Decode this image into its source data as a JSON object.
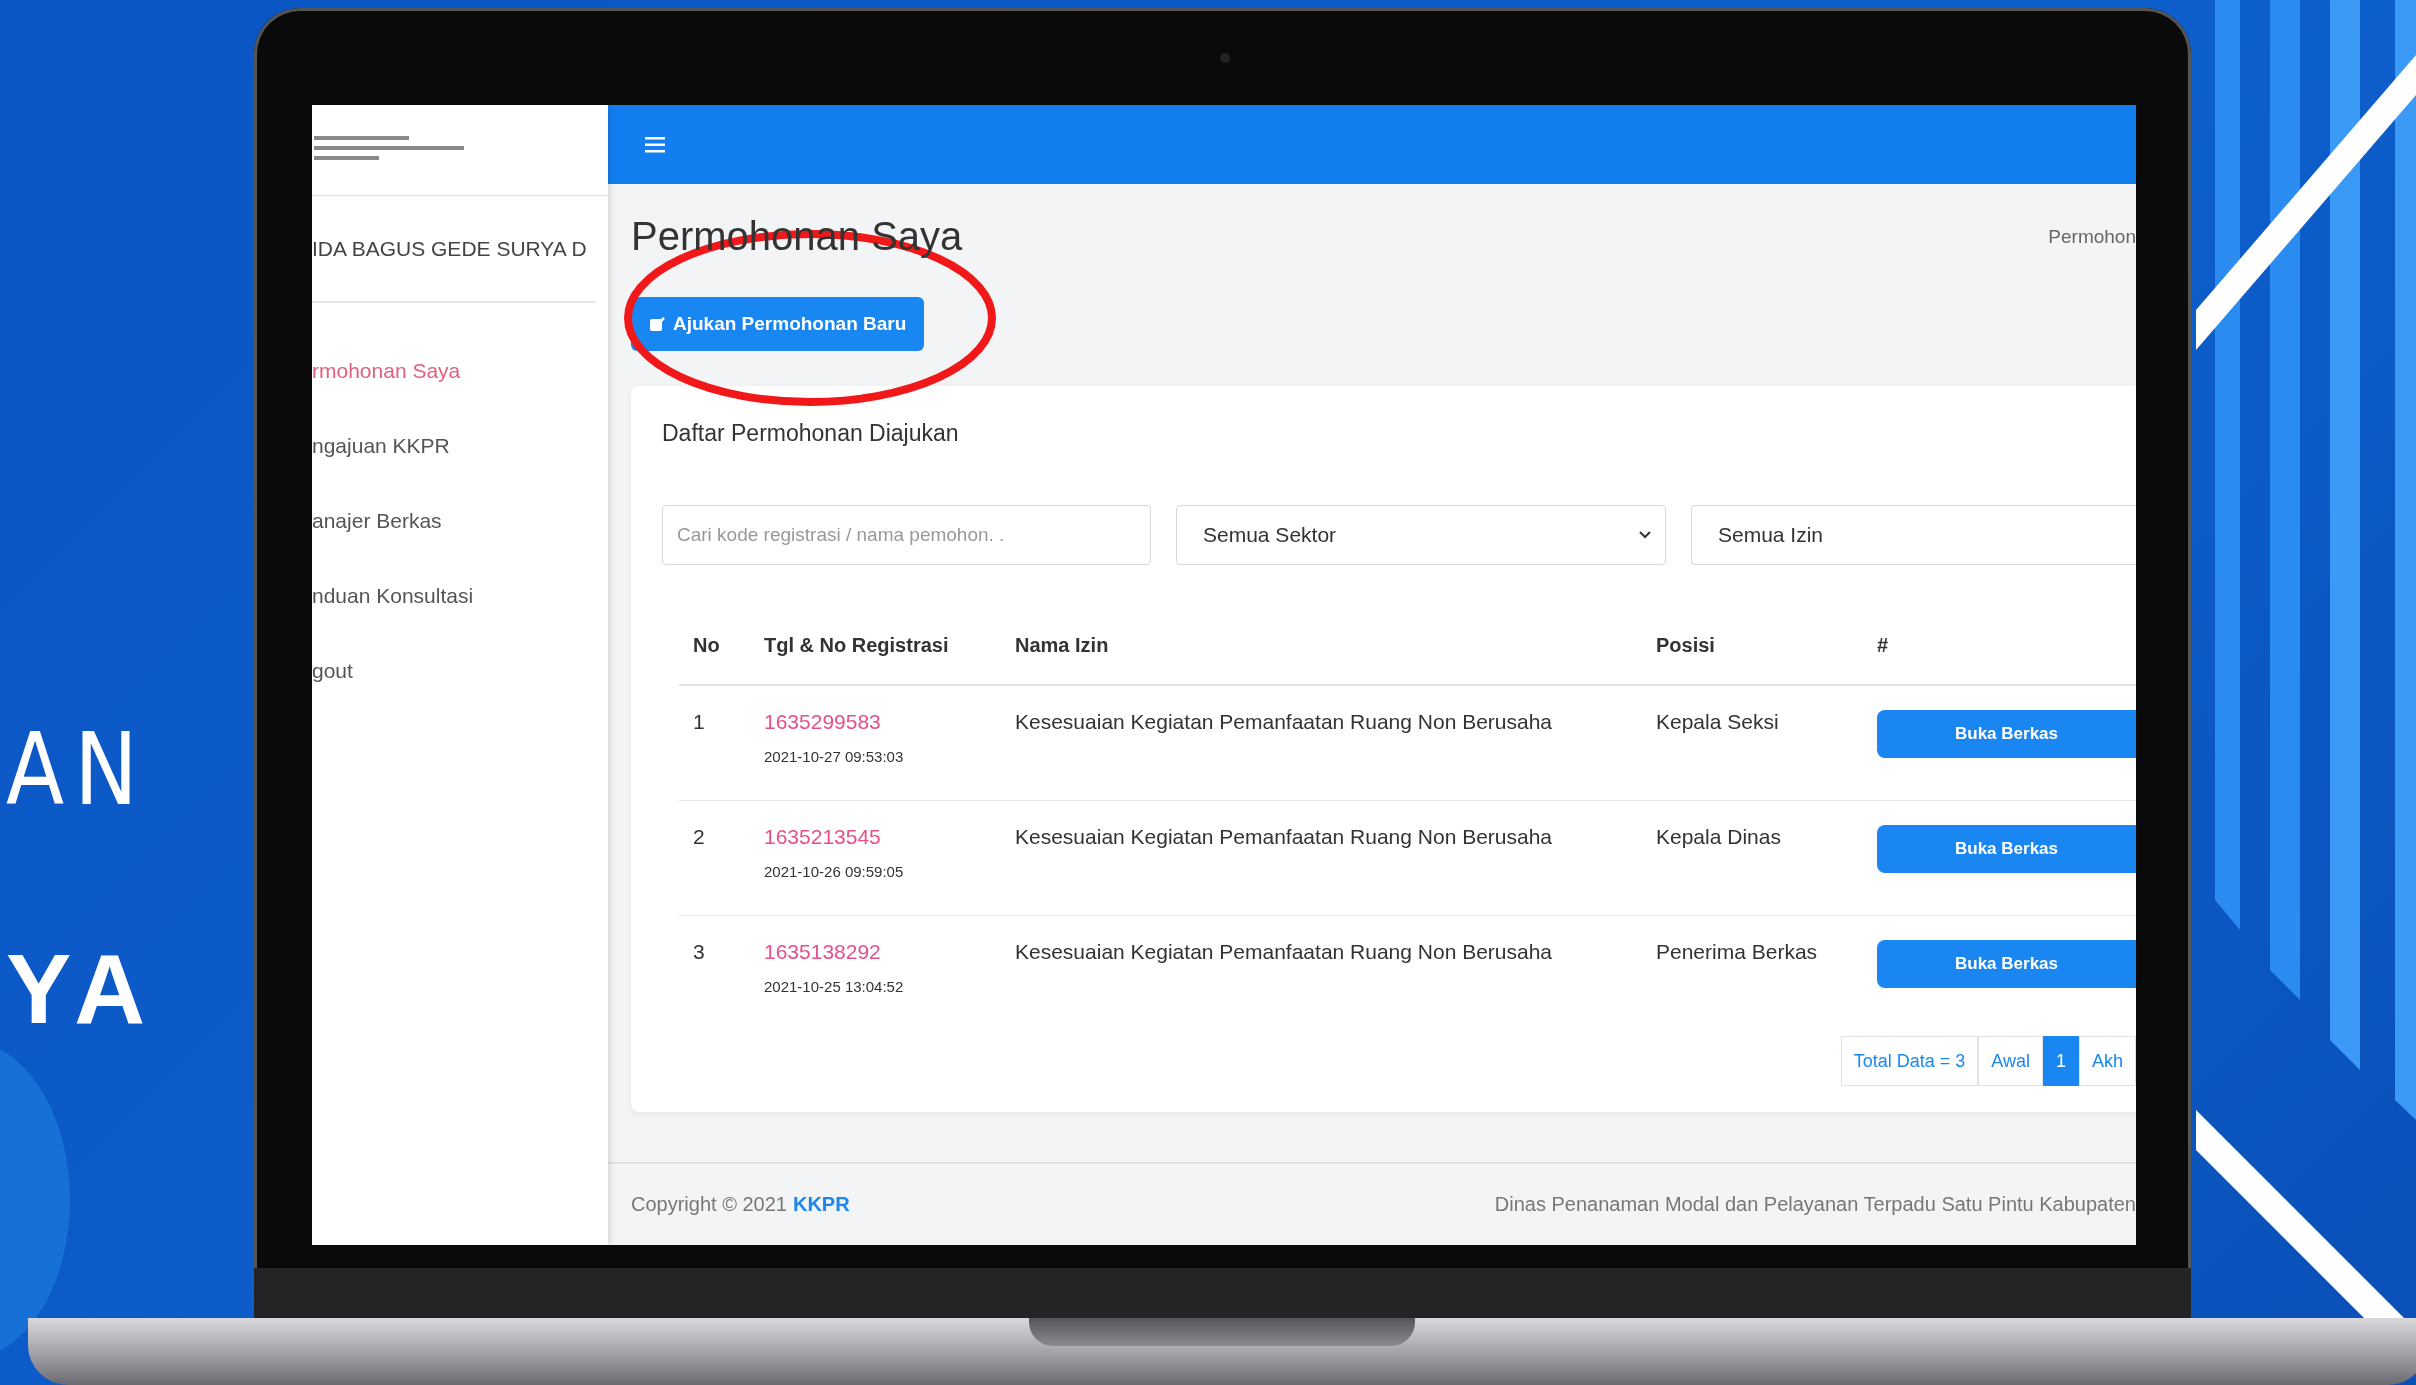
{
  "background_text": [
    {
      "text": "AN",
      "kind": "light"
    },
    {
      "text": "YA",
      "kind": "bold"
    }
  ],
  "sidebar": {
    "user_name": "IDA BAGUS GEDE SURYA D",
    "items": [
      {
        "label": "rmohonan Saya",
        "selected": true
      },
      {
        "label": "ngajuan KKPR",
        "selected": false
      },
      {
        "label": "anajer Berkas",
        "selected": false
      },
      {
        "label": "nduan Konsultasi",
        "selected": false
      },
      {
        "label": "gout",
        "selected": false
      }
    ]
  },
  "page": {
    "title": "Permohonan Saya",
    "breadcrumb": "Permohon",
    "new_button": "Ajukan Permohonan Baru"
  },
  "card": {
    "title": "Daftar Permohonan Diajukan",
    "search": {
      "placeholder": "Cari kode registrasi / nama pemohon. ."
    },
    "filters": [
      {
        "value": "Semua Sektor",
        "chevron": true
      },
      {
        "value": "Semua Izin",
        "chevron": false
      }
    ],
    "table": {
      "columns": [
        "No",
        "Tgl & No Registrasi",
        "Nama Izin",
        "Posisi",
        "#"
      ],
      "rows": [
        {
          "no": "1",
          "registration": "1635299583",
          "datetime": "2021-10-27 09:53:03",
          "permit": "Kesesuaian Kegiatan Pemanfaatan Ruang Non Berusaha",
          "position": "Kepala Seksi",
          "action": "Buka Berkas"
        },
        {
          "no": "2",
          "registration": "1635213545",
          "datetime": "2021-10-26 09:59:05",
          "permit": "Kesesuaian Kegiatan Pemanfaatan Ruang Non Berusaha",
          "position": "Kepala Dinas",
          "action": "Buka Berkas"
        },
        {
          "no": "3",
          "registration": "1635138292",
          "datetime": "2021-10-25 13:04:52",
          "permit": "Kesesuaian Kegiatan Pemanfaatan Ruang Non Berusaha",
          "position": "Penerima Berkas",
          "action": "Buka Berkas"
        }
      ]
    },
    "pagination": {
      "total": "Total Data = 3",
      "items": [
        {
          "label": "Awal",
          "selected": false
        },
        {
          "label": "1",
          "selected": true
        },
        {
          "label": "Akh",
          "selected": false
        }
      ]
    }
  },
  "footer": {
    "copyright": "Copyright © 2021",
    "brand": "KKPR",
    "agency": "Dinas Penanaman Modal dan Pelayanan Terpadu Satu Pintu Kabupaten"
  }
}
